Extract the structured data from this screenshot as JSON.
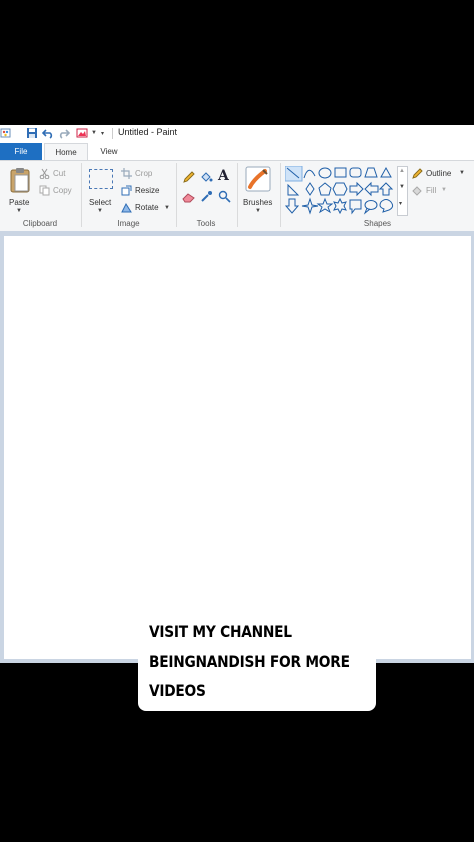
{
  "window": {
    "title": "Untitled - Paint"
  },
  "tabs": [
    {
      "label": "File"
    },
    {
      "label": "Home"
    },
    {
      "label": "View"
    }
  ],
  "ribbon": {
    "clipboard": {
      "label": "Clipboard",
      "paste": "Paste",
      "cut": "Cut",
      "copy": "Copy"
    },
    "image": {
      "label": "Image",
      "select": "Select",
      "crop": "Crop",
      "resize": "Resize",
      "rotate": "Rotate"
    },
    "tools": {
      "label": "Tools"
    },
    "brushes": {
      "label": "Brushes"
    },
    "shapes": {
      "label": "Shapes",
      "outline": "Outline",
      "fill": "Fill"
    }
  },
  "caption": {
    "line1": "VISIT MY CHANNEL",
    "line2": "BEINGNANDISH FOR MORE",
    "line3": "VIDEOS"
  },
  "colors": {
    "file_tab": "#1e6fc2",
    "ribbon_bg": "#f5f6f7",
    "canvas_bg": "#cad5e3",
    "shape_icon": "#1f5fa8"
  }
}
